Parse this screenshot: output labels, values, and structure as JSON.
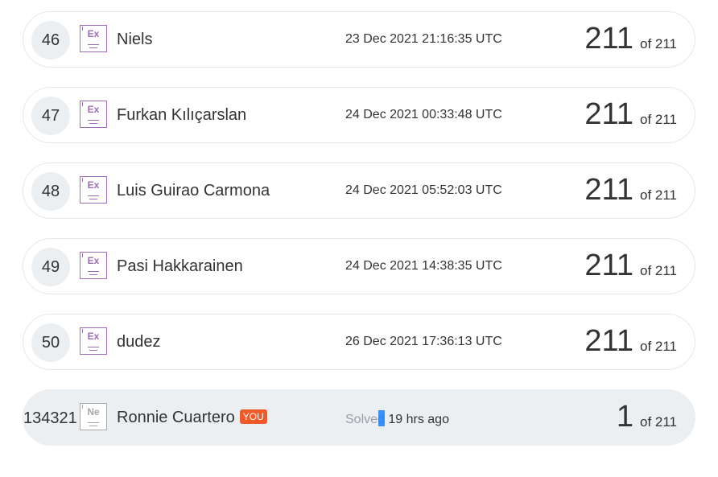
{
  "rows": [
    {
      "rank": "46",
      "badge": "Ex",
      "name": "Niels",
      "time": "23 Dec 2021 21:16:35 UTC",
      "score": "211",
      "of": "of 211"
    },
    {
      "rank": "47",
      "badge": "Ex",
      "name": "Furkan Kılıçarslan",
      "time": "24 Dec 2021 00:33:48 UTC",
      "score": "211",
      "of": "of 211"
    },
    {
      "rank": "48",
      "badge": "Ex",
      "name": "Luis Guirao Carmona",
      "time": "24 Dec 2021 05:52:03 UTC",
      "score": "211",
      "of": "of 211"
    },
    {
      "rank": "49",
      "badge": "Ex",
      "name": "Pasi Hakkarainen",
      "time": "24 Dec 2021 14:38:35 UTC",
      "score": "211",
      "of": "of 211"
    },
    {
      "rank": "50",
      "badge": "Ex",
      "name": "dudez",
      "time": "26 Dec 2021 17:36:13 UTC",
      "score": "211",
      "of": "of 211"
    }
  ],
  "me": {
    "rank": "134321",
    "badge": "Ne",
    "name": "Ronnie Cuartero",
    "you_label": "YOU",
    "solved_label": "Solved",
    "ago": " 19 hrs ago",
    "score": "1",
    "of": "of 211"
  },
  "colors": {
    "badge_purple": "#9f6cb8",
    "you_badge": "#f05a28",
    "current_row_bg": "#ebeff2"
  }
}
